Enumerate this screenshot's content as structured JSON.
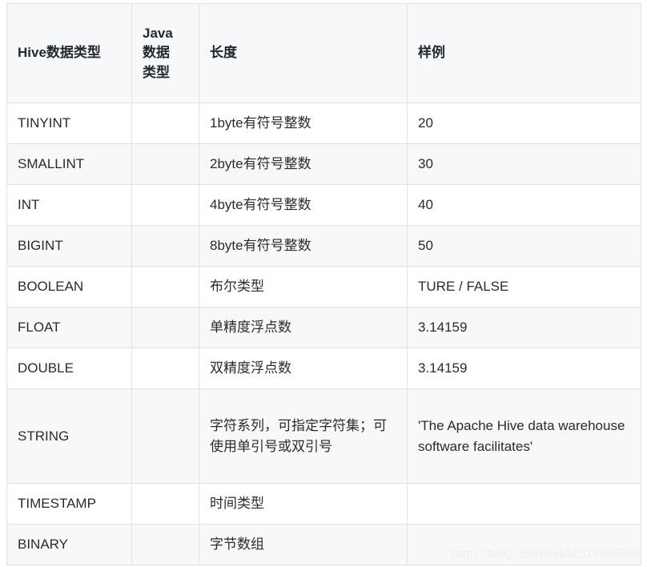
{
  "table": {
    "columns": [
      {
        "key": "hive_type",
        "label": "Hive数据类型"
      },
      {
        "key": "java_type",
        "label": "Java\n数据\n类型"
      },
      {
        "key": "length",
        "label": "长度"
      },
      {
        "key": "sample",
        "label": "样例"
      }
    ],
    "header": {
      "col0": "Hive数据类型",
      "col1_line1": "Java",
      "col1_line2": "数据",
      "col1_line3": "类型",
      "col2": "长度",
      "col3": "样例"
    },
    "rows": [
      {
        "hive_type": "TINYINT",
        "java_type": "",
        "length": "1byte有符号整数",
        "sample": "20"
      },
      {
        "hive_type": "SMALLINT",
        "java_type": "",
        "length": "2byte有符号整数",
        "sample": "30"
      },
      {
        "hive_type": "INT",
        "java_type": "",
        "length": "4byte有符号整数",
        "sample": "40"
      },
      {
        "hive_type": "BIGINT",
        "java_type": "",
        "length": "8byte有符号整数",
        "sample": "50"
      },
      {
        "hive_type": "BOOLEAN",
        "java_type": "",
        "length": "布尔类型",
        "sample": "TURE / FALSE"
      },
      {
        "hive_type": "FLOAT",
        "java_type": "",
        "length": "单精度浮点数",
        "sample": "3.14159"
      },
      {
        "hive_type": "DOUBLE",
        "java_type": "",
        "length": "双精度浮点数",
        "sample": "3.14159"
      },
      {
        "hive_type": "STRING",
        "java_type": "",
        "length": "字符系列，可指定字符集；可使用单引号或双引号",
        "sample": "'The Apache Hive data warehouse software facilitates'"
      },
      {
        "hive_type": "TIMESTAMP",
        "java_type": "",
        "length": "时间类型",
        "sample": ""
      },
      {
        "hive_type": "BINARY",
        "java_type": "",
        "length": "字节数组",
        "sample": ""
      }
    ]
  },
  "watermark": {
    "text": "https://blog.csdn.net/li1019865596"
  },
  "colors": {
    "border": "#dfe2e5",
    "header_bg": "#f6f8fa",
    "row_alt_bg": "#f6f8fa",
    "row_bg": "#ffffff",
    "header_text": "#24292e",
    "body_text": "#2b2b2b",
    "watermark_text": "#eceef0"
  }
}
